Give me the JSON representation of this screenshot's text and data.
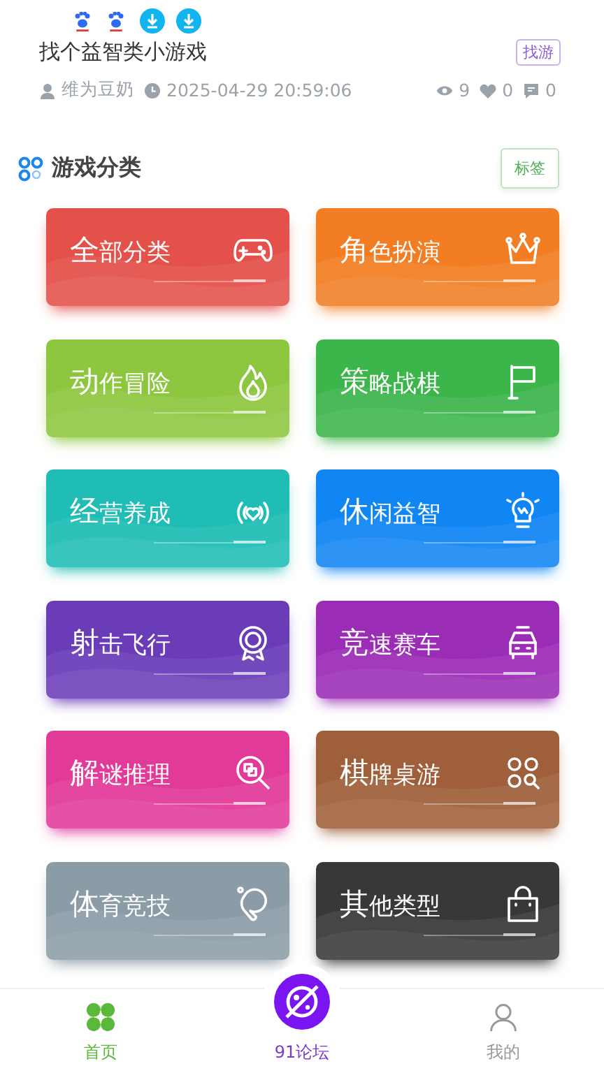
{
  "post": {
    "title": "找个益智类小游戏",
    "tag": "找游",
    "author": "维为豆奶",
    "time": "2025-04-29 20:59:06",
    "views": "9",
    "likes": "0",
    "comments": "0"
  },
  "section": {
    "title": "游戏分类",
    "button": "标签"
  },
  "categories": [
    {
      "title": "全部分类",
      "color": "#e4504a"
    },
    {
      "title": "角色扮演",
      "color": "#f27d22"
    },
    {
      "title": "动作冒险",
      "color": "#8dc63f"
    },
    {
      "title": "策略战棋",
      "color": "#3cb54b"
    },
    {
      "title": "经营养成",
      "color": "#1fbdb5"
    },
    {
      "title": "休闲益智",
      "color": "#1085f4"
    },
    {
      "title": "射击飞行",
      "color": "#6a3cb8"
    },
    {
      "title": "竞速赛车",
      "color": "#9b2cb6"
    },
    {
      "title": "解谜推理",
      "color": "#e23a98"
    },
    {
      "title": "棋牌桌游",
      "color": "#9f5f3a"
    },
    {
      "title": "体育竞技",
      "color": "#8c9ca7"
    },
    {
      "title": "其他类型",
      "color": "#383838"
    }
  ],
  "tabs": [
    {
      "label": "首页",
      "selected": true
    },
    {
      "label": "91论坛",
      "selected": false
    },
    {
      "label": "我的",
      "selected": false
    }
  ]
}
